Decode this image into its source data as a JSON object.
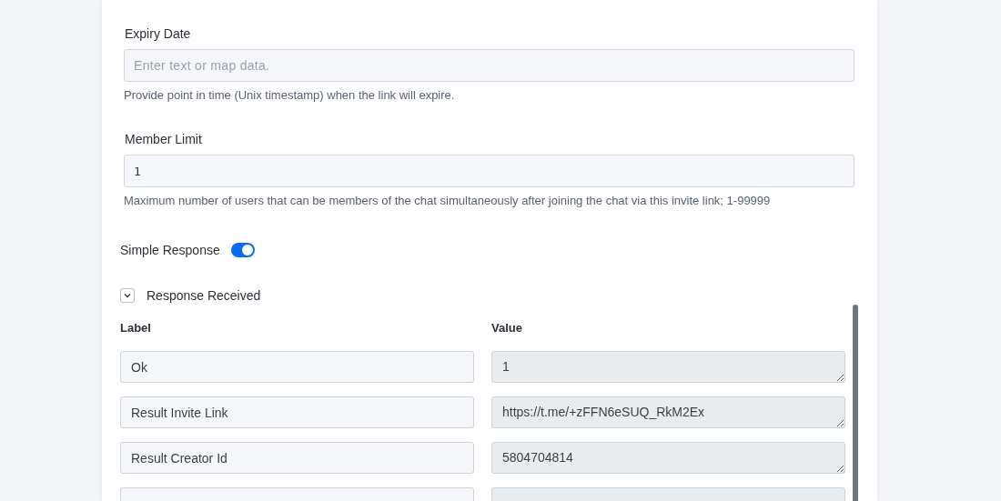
{
  "fields": [
    {
      "label": "Expiry Date",
      "placeholder": "Enter text or map data.",
      "help": "Provide point in time (Unix timestamp) when the link will expire."
    },
    {
      "label": "Member Limit",
      "value": "1",
      "help": "Maximum number of users that can be members of the chat simultaneously after joining the chat via this invite link; 1-99999"
    }
  ],
  "simple_response": {
    "label": "Simple Response",
    "on": true
  },
  "response": {
    "title": "Response Received",
    "expanded": true,
    "columns": [
      "Label",
      "Value"
    ],
    "rows": [
      {
        "label": "Ok",
        "value": "1"
      },
      {
        "label": "Result Invite Link",
        "value": "https://t.me/+zFFN6eSUQ_RkM2Ex"
      },
      {
        "label": "Result Creator Id",
        "value": "5804704814"
      },
      {}
    ]
  }
}
